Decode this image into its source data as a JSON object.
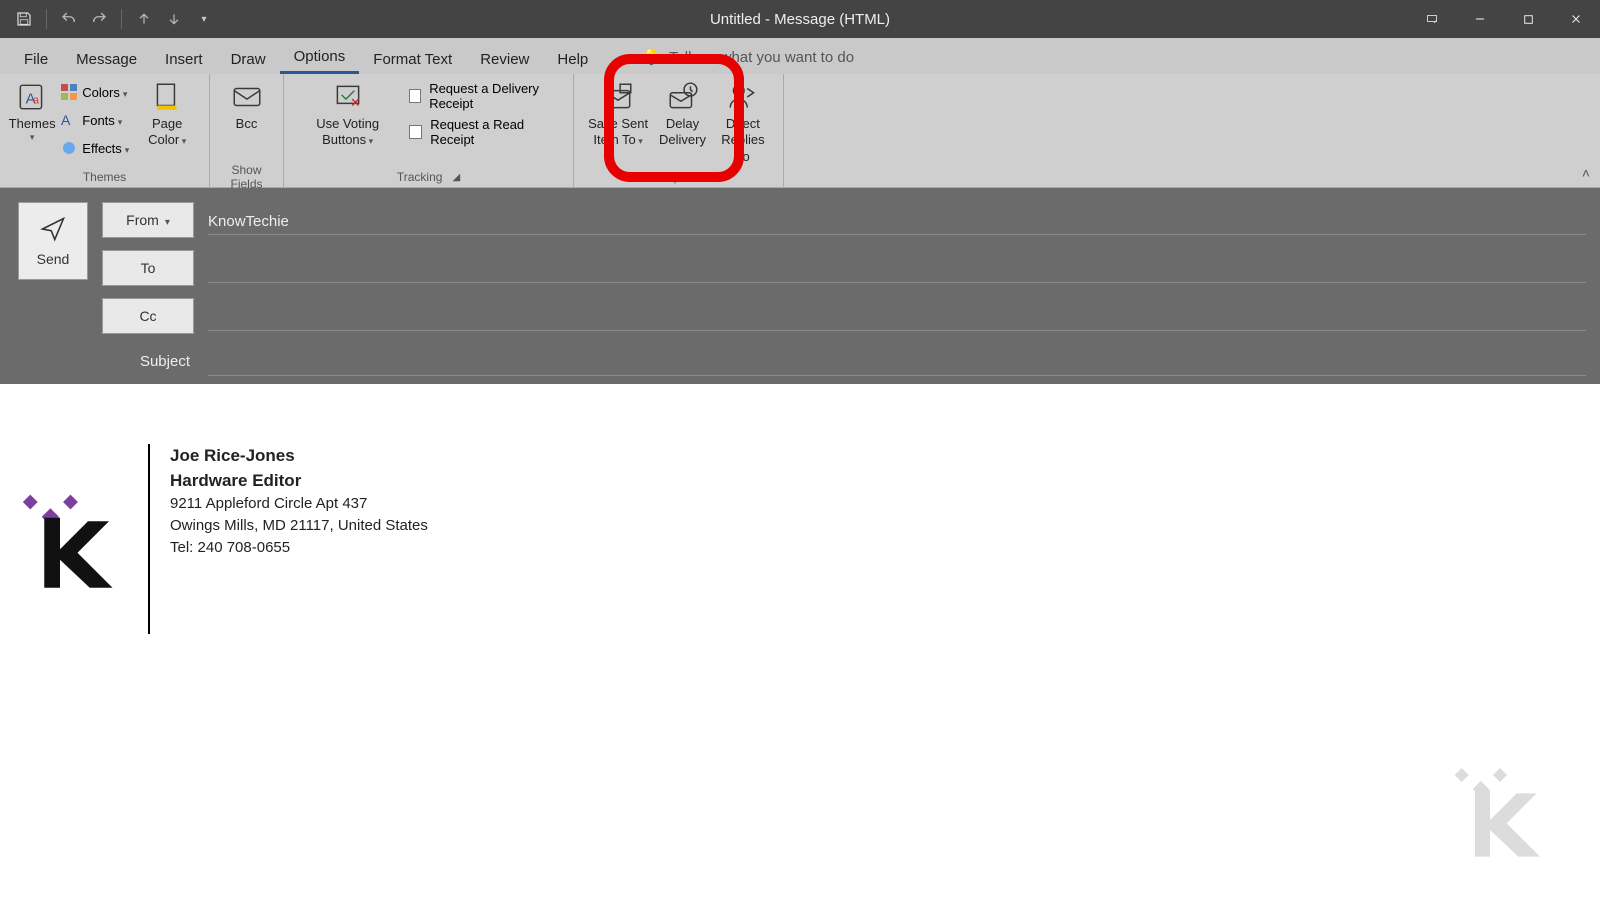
{
  "window": {
    "title": "Untitled  -  Message (HTML)"
  },
  "tabs": {
    "file": "File",
    "message": "Message",
    "insert": "Insert",
    "draw": "Draw",
    "options": "Options",
    "format_text": "Format Text",
    "review": "Review",
    "help": "Help",
    "tellme": "Tell me what you want to do",
    "active": "options"
  },
  "ribbon": {
    "themes": {
      "themes": "Themes",
      "colors": "Colors",
      "fonts": "Fonts",
      "effects": "Effects",
      "page_color": "Page Color",
      "group_label": "Themes"
    },
    "show_fields": {
      "bcc": "Bcc",
      "group_label": "Show Fields"
    },
    "tracking": {
      "voting": "Use Voting Buttons",
      "delivery_receipt": "Request a Delivery Receipt",
      "read_receipt": "Request a Read Receipt",
      "group_label": "Tracking"
    },
    "more_options": {
      "save_sent": "Save Sent Item To",
      "delay_delivery": "Delay Delivery",
      "direct_replies": "Direct Replies To",
      "group_label": "More Options"
    }
  },
  "header": {
    "send": "Send",
    "from_label": "From",
    "from_value": "KnowTechie",
    "to_label": "To",
    "to_value": "",
    "cc_label": "Cc",
    "cc_value": "",
    "subject_label": "Subject",
    "subject_value": ""
  },
  "signature": {
    "name": "Joe Rice-Jones",
    "title": "Hardware Editor",
    "addr1": "9211 Appleford Circle Apt 437",
    "addr2": "Owings Mills, MD 21117, United States",
    "tel": "Tel: 240 708-0655"
  }
}
